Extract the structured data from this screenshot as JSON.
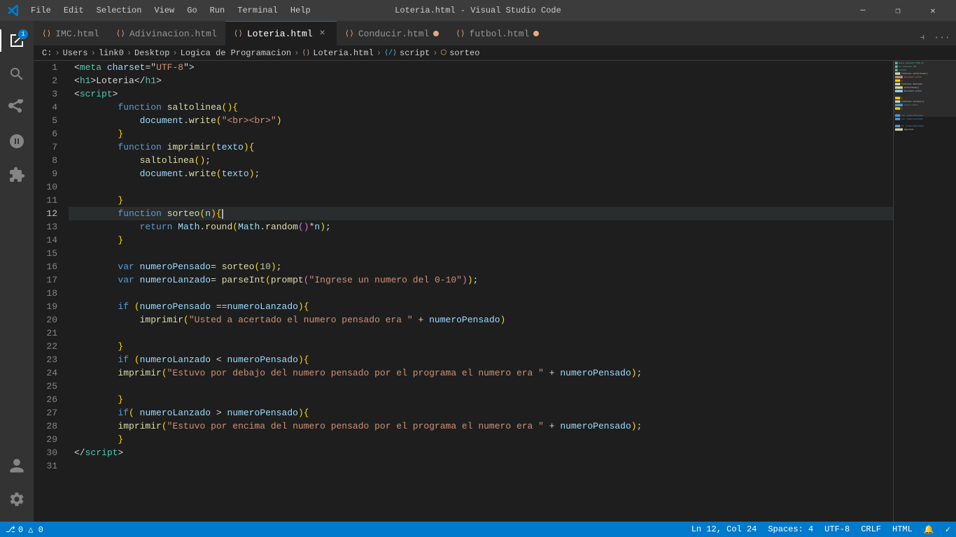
{
  "titlebar": {
    "title": "Loteria.html - Visual Studio Code",
    "menu": [
      "File",
      "Edit",
      "Selection",
      "View",
      "Go",
      "Run",
      "Terminal",
      "Help"
    ],
    "controls": [
      "minimize",
      "restore",
      "close"
    ]
  },
  "tabs": [
    {
      "id": "imc",
      "label": "IMC.html",
      "active": false,
      "dot": false,
      "closeable": false
    },
    {
      "id": "adivinacion",
      "label": "Adivinacion.html",
      "active": false,
      "dot": false,
      "closeable": false
    },
    {
      "id": "loteria",
      "label": "Loteria.html",
      "active": true,
      "dot": false,
      "closeable": true
    },
    {
      "id": "conducir",
      "label": "Conducir.html",
      "active": false,
      "dot": true,
      "closeable": false
    },
    {
      "id": "futbol",
      "label": "futbol.html",
      "active": false,
      "dot": true,
      "closeable": false
    }
  ],
  "breadcrumb": {
    "items": [
      "C:",
      "Users",
      "link0",
      "Desktop",
      "Logica de Programacion",
      "Loteria.html",
      "script",
      "sorteo"
    ]
  },
  "statusbar": {
    "left": [
      {
        "icon": "git",
        "text": "0 △ 0"
      }
    ],
    "right": [
      {
        "text": "Ln 12, Col 24"
      },
      {
        "text": "Spaces: 4"
      },
      {
        "text": "UTF-8"
      },
      {
        "text": "CRLF"
      },
      {
        "text": "HTML"
      },
      {
        "icon": "bell"
      },
      {
        "icon": "check"
      }
    ]
  },
  "code": {
    "lines": [
      {
        "num": 1,
        "content": "meta_charset"
      },
      {
        "num": 2,
        "content": "h1_loteria"
      },
      {
        "num": 3,
        "content": "script_open"
      },
      {
        "num": 4,
        "content": "fn_saltolinea"
      },
      {
        "num": 5,
        "content": "doc_write_br"
      },
      {
        "num": 6,
        "content": "close_brace1"
      },
      {
        "num": 7,
        "content": "fn_imprimir"
      },
      {
        "num": 8,
        "content": "call_saltolinea"
      },
      {
        "num": 9,
        "content": "doc_write_texto"
      },
      {
        "num": 10,
        "content": "empty"
      },
      {
        "num": 11,
        "content": "close_brace2"
      },
      {
        "num": 12,
        "content": "fn_sorteo"
      },
      {
        "num": 13,
        "content": "return_math"
      },
      {
        "num": 14,
        "content": "close_brace3"
      },
      {
        "num": 15,
        "content": "empty"
      },
      {
        "num": 16,
        "content": "var_numeroPensado"
      },
      {
        "num": 17,
        "content": "var_numeroLanzado"
      },
      {
        "num": 18,
        "content": "empty"
      },
      {
        "num": 19,
        "content": "if_equal"
      },
      {
        "num": 20,
        "content": "imprimir_acertado"
      },
      {
        "num": 21,
        "content": "empty"
      },
      {
        "num": 22,
        "content": "close_brace4"
      },
      {
        "num": 23,
        "content": "if_menor"
      },
      {
        "num": 24,
        "content": "imprimir_debajo"
      },
      {
        "num": 25,
        "content": "empty"
      },
      {
        "num": 26,
        "content": "close_brace5"
      },
      {
        "num": 27,
        "content": "if_mayor"
      },
      {
        "num": 28,
        "content": "imprimir_encima"
      },
      {
        "num": 29,
        "content": "close_brace6"
      },
      {
        "num": 30,
        "content": "script_close"
      },
      {
        "num": 31,
        "content": "empty"
      }
    ]
  }
}
